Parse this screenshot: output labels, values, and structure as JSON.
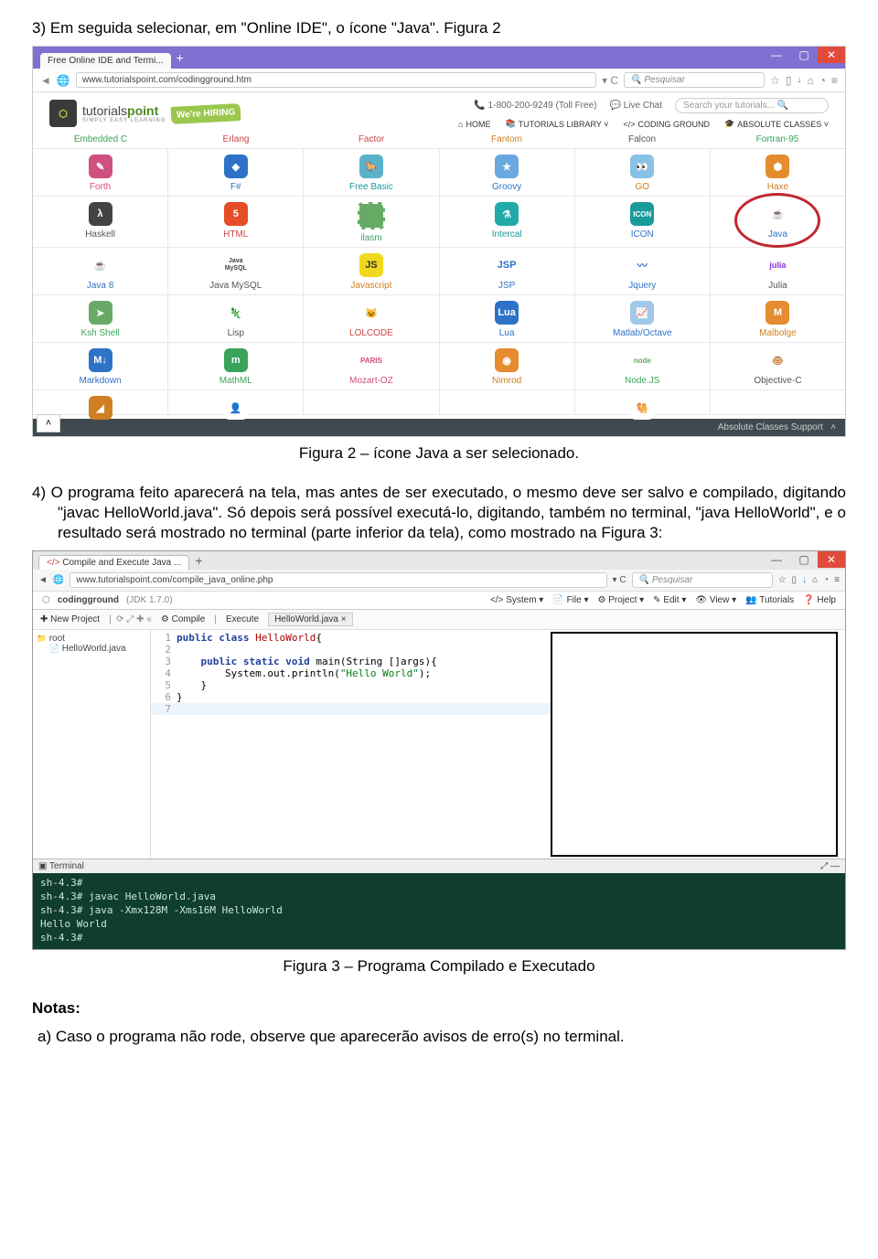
{
  "doc": {
    "step3": "3)  Em seguida selecionar, em \"Online IDE\", o ícone \"Java\". Figura 2",
    "caption2": "Figura 2 – ícone Java a ser selecionado.",
    "step4": "4)   O programa feito aparecerá na tela, mas antes de ser executado, o mesmo deve ser salvo e compilado, digitando \"javac HelloWorld.java\". Só depois será possível executá-lo, digitando, também no terminal, \"java HelloWorld\", e o resultado será mostrado no terminal (parte inferior da tela), como mostrado na Figura 3:",
    "caption3": "Figura 3 – Programa Compilado e Executado",
    "notas": "Notas:",
    "item_a": "a)   Caso o programa não rode, observe que aparecerão avisos de erro(s) no terminal."
  },
  "fig2": {
    "tab_title": "Free Online IDE and Termi...",
    "url": "www.tutorialspoint.com/codingground.htm",
    "search_placeholder": "Pesquisar",
    "brand_plain": "tutorials",
    "brand_accent": "point",
    "brand_sub": "SIMPLY EASY LEARNING",
    "hiring": "We're HIRING",
    "phone": "1-800-200-9249 (Toll Free)",
    "live_chat": "Live Chat",
    "search_tut": "Search your tutorials...",
    "nav_home": "HOME",
    "nav_lib": "TUTORIALS LIBRARY ˅",
    "nav_cg": "CODING GROUND",
    "nav_abs": "ABSOLUTE CLASSES ˅",
    "top_row": [
      "Embedded C",
      "Erlang",
      "Factor",
      "Fantom",
      "Falcon",
      "Fortran-95"
    ],
    "grid": [
      [
        "Forth",
        "F#",
        "Free Basic",
        "Groovy",
        "GO",
        "Haxe"
      ],
      [
        "Haskell",
        "HTML",
        "ilasm",
        "Intercal",
        "ICON",
        "Java"
      ],
      [
        "Java 8",
        "Java MySQL",
        "Javascript",
        "JSP",
        "Jquery",
        "Julia"
      ],
      [
        "Ksh Shell",
        "Lisp",
        "LOLCODE",
        "Lua",
        "Matlab/Octave",
        "Malbolge"
      ],
      [
        "Markdown",
        "MathML",
        "Mozart-OZ",
        "Nimrod",
        "Node.JS",
        "Objective-C"
      ]
    ],
    "footer": "Absolute Classes Support"
  },
  "fig3": {
    "tab_title": "Compile and Execute Java ...",
    "url": "www.tutorialspoint.com/compile_java_online.php",
    "search_placeholder": "Pesquisar",
    "brand": "codingground",
    "jdk": "(JDK 1.7.0)",
    "menu_right": [
      "System ▾",
      "File ▾",
      "Project ▾",
      "Edit ▾",
      "View ▾",
      "Tutorials",
      "Help"
    ],
    "menu_right_icons": [
      "</>",
      "📄",
      "⚙",
      "✎",
      "👁",
      "👥",
      "❓"
    ],
    "tb_new": "New Project",
    "tb_compile": "Compile",
    "tb_execute": "Execute",
    "tb_file": "HelloWorld.java ×",
    "tree_root": "root",
    "tree_file": "HelloWorld.java",
    "code_lines": [
      "public class HelloWorld{",
      "",
      "    public static void main(String []args){",
      "        System.out.println(\"Hello World\");",
      "    }",
      "}",
      ""
    ],
    "terminal_label": "Terminal",
    "terminal": "sh-4.3#\nsh-4.3# javac HelloWorld.java\nsh-4.3# java -Xmx128M -Xms16M HelloWorld\nHello World\nsh-4.3# "
  }
}
